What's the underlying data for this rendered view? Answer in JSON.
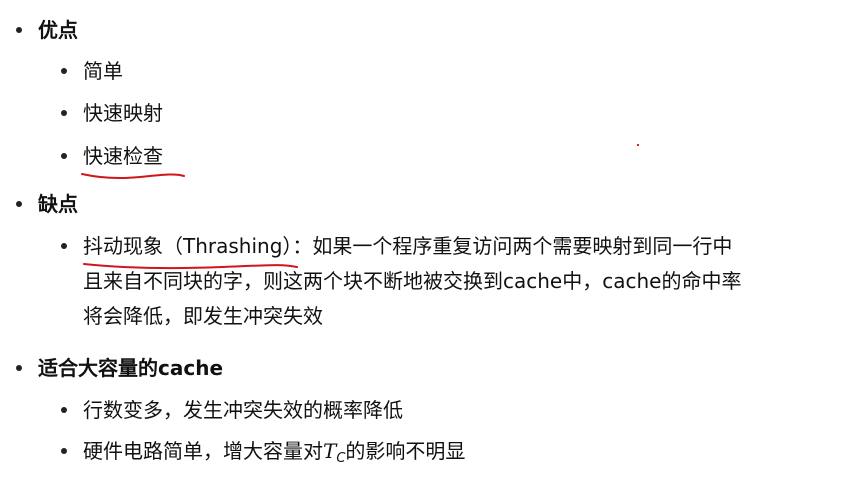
{
  "advantages": {
    "heading": "优点",
    "items": [
      "简单",
      "快速映射",
      "快速检查"
    ]
  },
  "disadvantages": {
    "heading": "缺点",
    "item": {
      "term": "抖动现象（Thrashing）",
      "text_line1": "：如果一个程序重复访问两个需要映射到同一行中",
      "text_line2": "且来自不同块的字，则这两个块不断地被交换到cache中，cache的命中率",
      "text_line3": "将会降低，即发生冲突失效"
    }
  },
  "large_cache": {
    "heading": "适合大容量的cache",
    "items": [
      "行数变多，发生冲突失效的概率降低",
      {
        "prefix": "硬件电路简单，增大容量对",
        "math_var": "T",
        "math_sub": "C",
        "suffix": "的影响不明显"
      }
    ]
  },
  "annotation_color": "#d0161c"
}
